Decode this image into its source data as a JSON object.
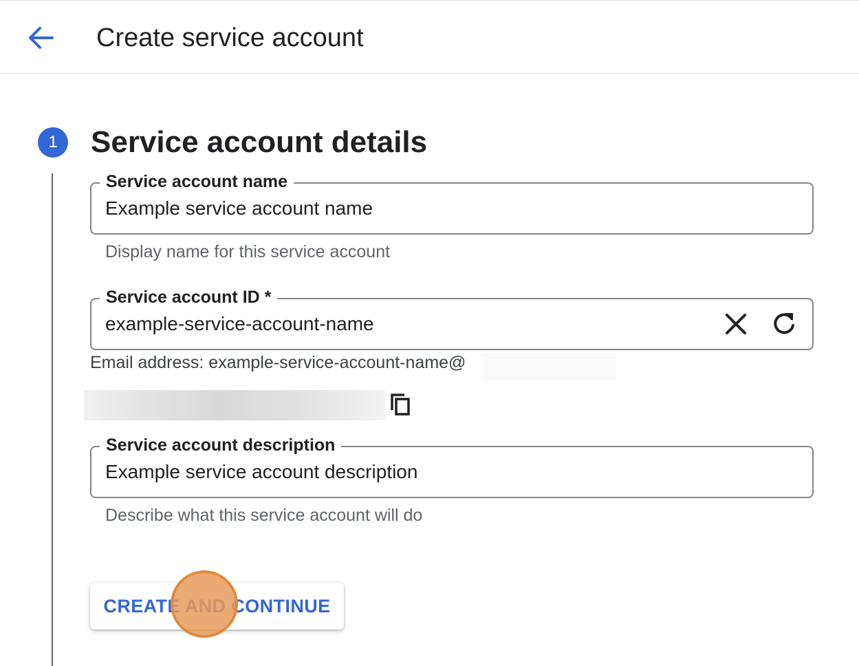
{
  "header": {
    "title": "Create service account",
    "back_icon": "arrow-back-icon"
  },
  "step": {
    "number": "1",
    "title": "Service account details"
  },
  "fields": {
    "name": {
      "label": "Service account name",
      "value": "Example service account name",
      "hint": "Display name for this service account"
    },
    "id": {
      "label": "Service account ID *",
      "value": "example-service-account-name",
      "clear_icon": "close-icon",
      "regenerate_icon": "refresh-icon"
    },
    "email": {
      "text": "Email address: example-service-account-name@",
      "copy_icon": "copy-icon"
    },
    "description": {
      "label": "Service account description",
      "value": "Example service account description",
      "hint": "Describe what this service account will do"
    }
  },
  "actions": {
    "primary_label": "CREATE AND CONTINUE"
  },
  "colors": {
    "accent": "#3367d6",
    "click_marker": "#e3893f"
  }
}
